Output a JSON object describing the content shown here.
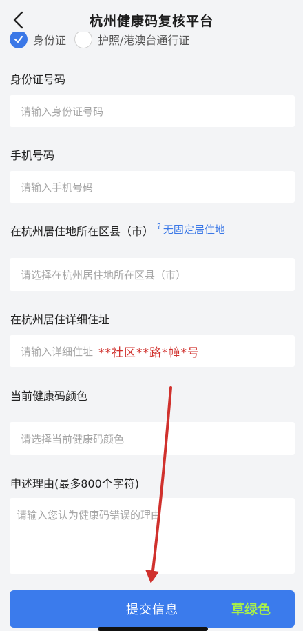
{
  "header": {
    "title": "杭州健康码复核平台"
  },
  "id_type": {
    "option_id_card": "身份证",
    "option_passport": "护照/港澳台通行证"
  },
  "fields": {
    "id_number": {
      "label": "身份证号码",
      "placeholder": "请输入身份证号码"
    },
    "phone": {
      "label": "手机号码",
      "placeholder": "请输入手机号码"
    },
    "district": {
      "label": "在杭州居住地所在区县（市）",
      "hint": "无固定居住地",
      "placeholder": "请选择在杭州居住地所在区县（市）"
    },
    "address": {
      "label": "在杭州居住详细住址",
      "placeholder": "请输入详细住址",
      "overlay_text": "**社区**路*幢*号"
    },
    "code_color": {
      "label": "当前健康码颜色",
      "placeholder": "请选择当前健康码颜色"
    },
    "reason": {
      "label": "申述理由(最多800个字符)",
      "placeholder": "请输入您认为健康码错误的理由"
    }
  },
  "submit": {
    "label": "提交信息",
    "overlay_note": "草绿色"
  },
  "colors": {
    "accent": "#3b7bec",
    "annotation_red": "#d0312d",
    "annotation_green": "#a8f04a"
  }
}
